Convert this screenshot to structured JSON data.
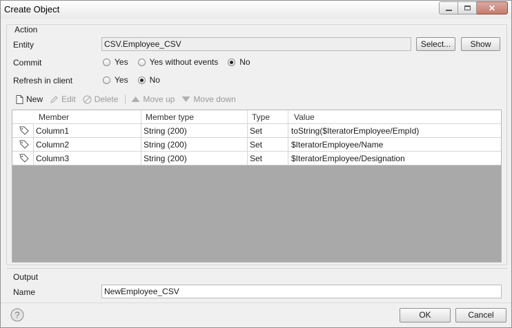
{
  "window": {
    "title": "Create Object"
  },
  "action": {
    "section_label": "Action",
    "entity_label": "Entity",
    "entity_value": "CSV.Employee_CSV",
    "select_button": "Select...",
    "show_button": "Show",
    "commit_label": "Commit",
    "commit_options": [
      "Yes",
      "Yes without events",
      "No"
    ],
    "commit_selected": "No",
    "refresh_label": "Refresh in client",
    "refresh_options": [
      "Yes",
      "No"
    ],
    "refresh_selected": "No"
  },
  "toolbar": {
    "new": "New",
    "edit": "Edit",
    "delete": "Delete",
    "move_up": "Move up",
    "move_down": "Move down"
  },
  "members_table": {
    "columns": [
      "Member",
      "Member type",
      "Type",
      "Value"
    ],
    "rows": [
      {
        "member": "Column1",
        "member_type": "String (200)",
        "type": "Set",
        "value": "toString($IteratorEmployee/EmpId)"
      },
      {
        "member": "Column2",
        "member_type": "String (200)",
        "type": "Set",
        "value": "$IteratorEmployee/Name"
      },
      {
        "member": "Column3",
        "member_type": "String (200)",
        "type": "Set",
        "value": "$IteratorEmployee/Designation"
      }
    ]
  },
  "output": {
    "section_label": "Output",
    "name_label": "Name",
    "name_value": "NewEmployee_CSV"
  },
  "footer": {
    "ok_button": "OK",
    "cancel_button": "Cancel"
  }
}
